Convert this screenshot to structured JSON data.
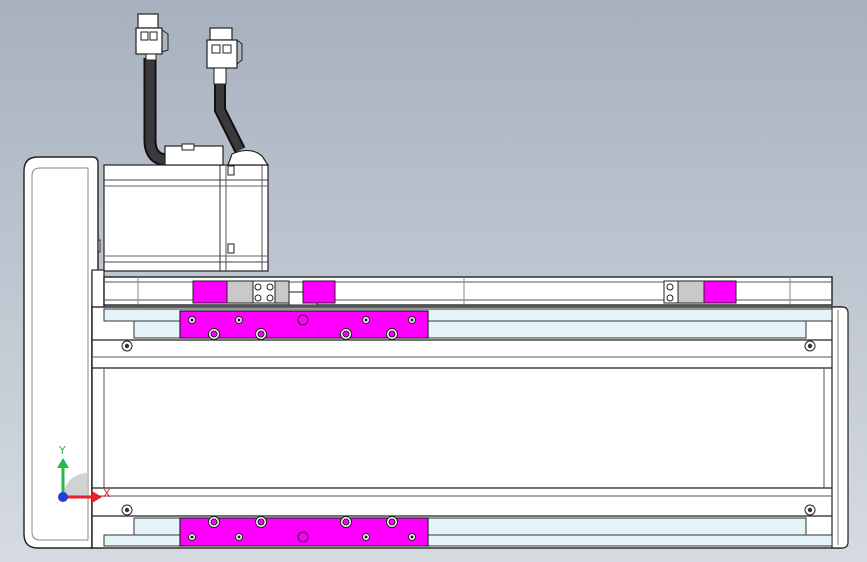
{
  "viewport": {
    "background_top": "#a7b0bd",
    "background_bottom": "#d6dbe2"
  },
  "colors": {
    "body": "#ffffff",
    "edge": "#2b2b2b",
    "rail_tint": "#e4f3f8",
    "highlight": "#ff00ff",
    "cable": "#1a1a1a",
    "block_grey": "#c9c9c9"
  },
  "triad": {
    "x_label": "X",
    "y_label": "Y",
    "x_color": "#e8202a",
    "y_color": "#27b84a",
    "z_color": "#1f3fd8"
  }
}
